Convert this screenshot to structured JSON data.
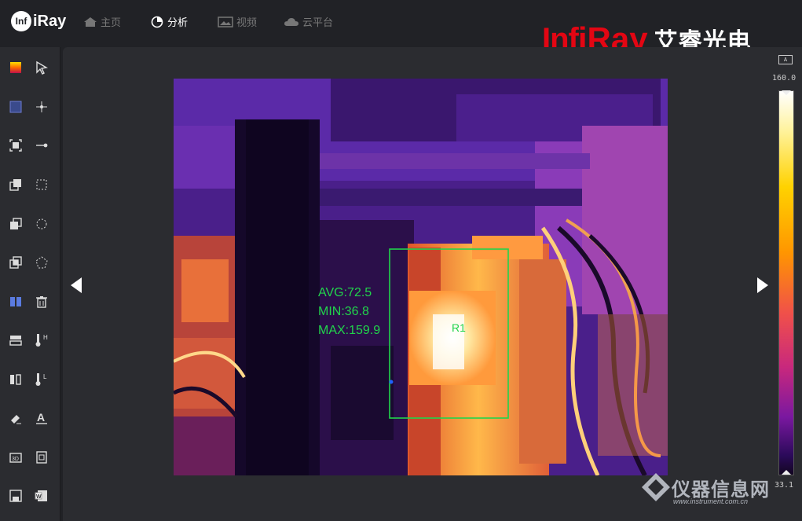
{
  "app": {
    "logo_text": "iRay",
    "logo_mark": "Inf"
  },
  "nav": [
    {
      "label": "主页",
      "icon": "home-icon"
    },
    {
      "label": "分析",
      "icon": "pie-chart-icon",
      "active": true
    },
    {
      "label": "视频",
      "icon": "image-icon"
    },
    {
      "label": "云平台",
      "icon": "cloud-icon"
    }
  ],
  "brand": {
    "inf": "Inf",
    "ray": "iRay",
    "cn": "艾睿光电"
  },
  "toolbar": {
    "left": [
      "palette-icon",
      "color-swatch-icon",
      "image-frame-icon",
      "layer-front-icon",
      "layer-back-icon",
      "layer-copy-icon",
      "compare-split-icon",
      "split-horizontal-icon",
      "split-vertical-icon",
      "eraser-icon",
      "3d-box-icon",
      "save-icon"
    ],
    "right": [
      "pointer-icon",
      "spot-measure-icon",
      "line-measure-icon",
      "rect-measure-icon",
      "circle-measure-icon",
      "polygon-measure-icon",
      "delete-icon",
      "thermometer-high-icon",
      "thermometer-low-icon",
      "text-annotate-icon",
      "screenshot-icon",
      "word-export-icon"
    ],
    "labels": {
      "high": "H",
      "low": "L",
      "text": "A"
    }
  },
  "measurement": {
    "avg": "AVG:72.5",
    "min": "MIN:36.8",
    "max": "MAX:159.9",
    "region": "R1",
    "color": "#21d44b"
  },
  "scale": {
    "badge": "A",
    "max": "160.0",
    "min": "33.1"
  },
  "watermark": {
    "cn": "仪器信息网",
    "url": "www.instrument.com.cn"
  },
  "colors": {
    "background": "#212226",
    "panel": "#2b2c30",
    "brand": "#e30613",
    "accent": "#ff7a1a"
  }
}
